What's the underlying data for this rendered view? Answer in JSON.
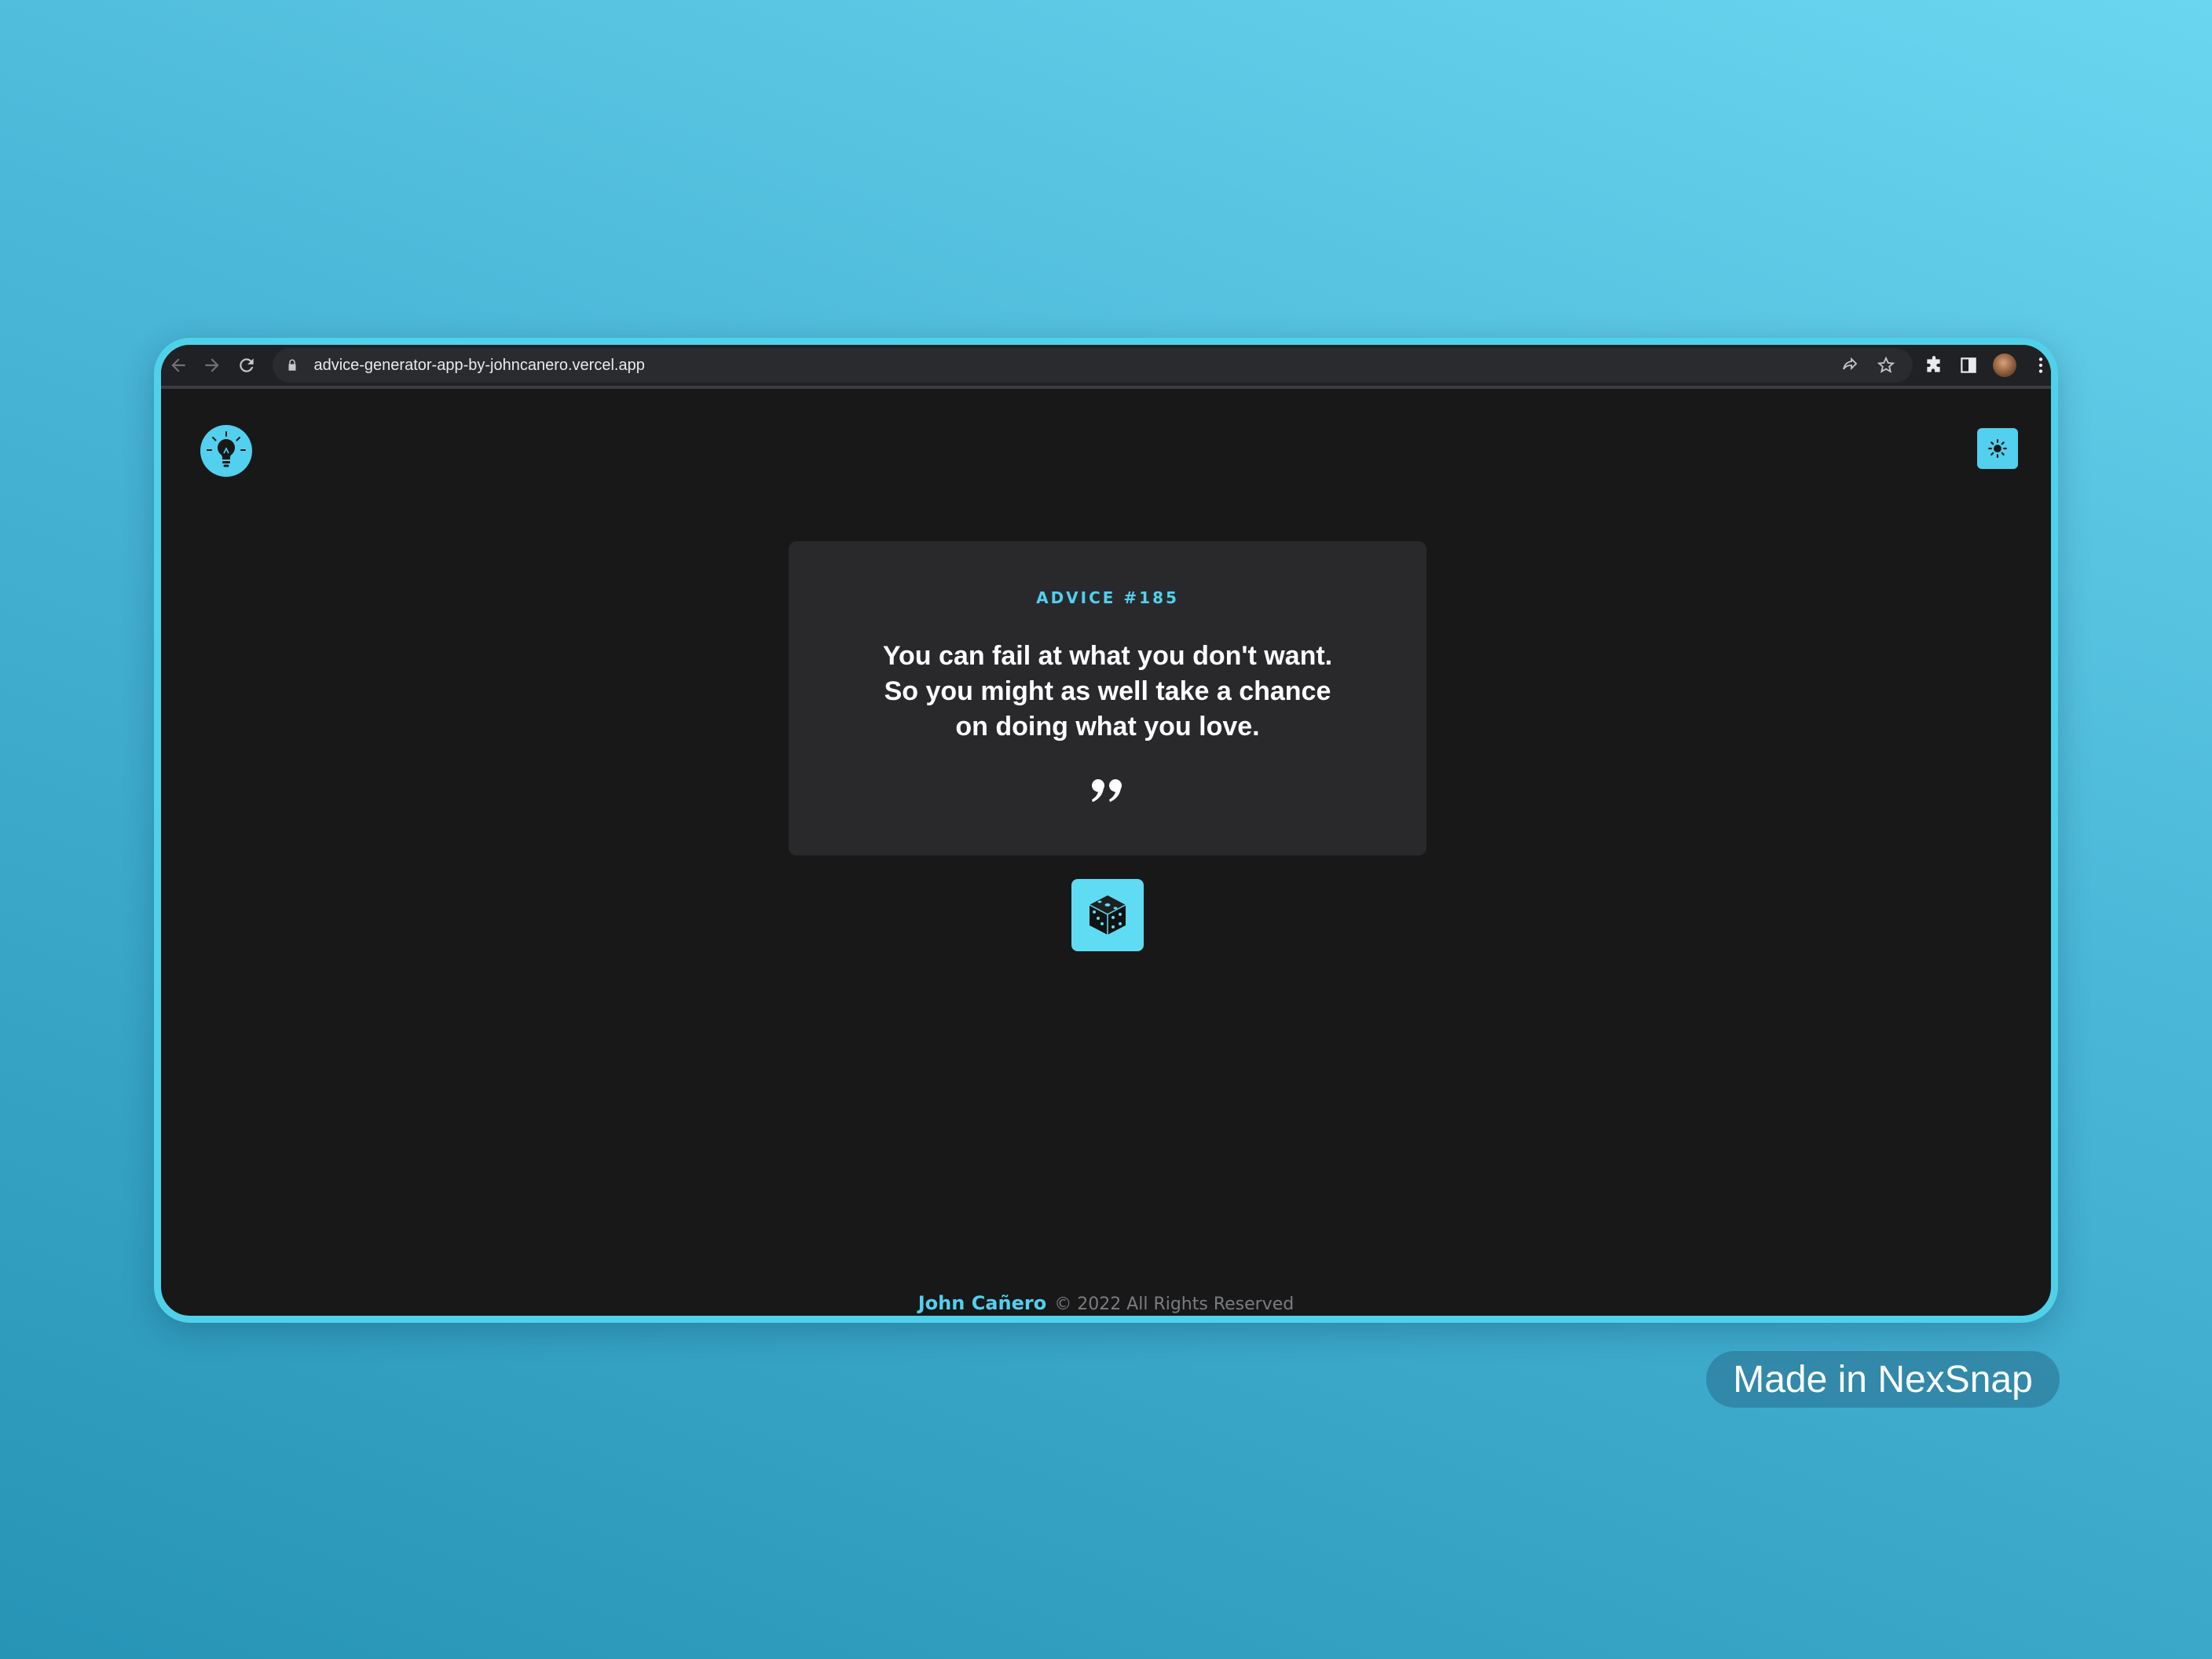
{
  "browser": {
    "url": "advice-generator-app-by-johncanero.vercel.app"
  },
  "app": {
    "logo_icon": "lightbulb-icon",
    "theme_toggle_icon": "sun-icon",
    "advice_label": "ADVICE #185",
    "advice_text": "You can fail at what you don't want. So you might as well take a chance on doing what you love.",
    "quote_icon": "quote-mark-icon",
    "dice_icon": "dice-icon"
  },
  "footer": {
    "author": "John Cañero",
    "rights": "© 2022 All Rights Reserved"
  },
  "watermark": {
    "label": "Made in NexSnap"
  },
  "colors": {
    "accent": "#52d0ee",
    "page_bg": "#181819",
    "card_bg": "#29292c",
    "frame": "#4fd1ea"
  }
}
